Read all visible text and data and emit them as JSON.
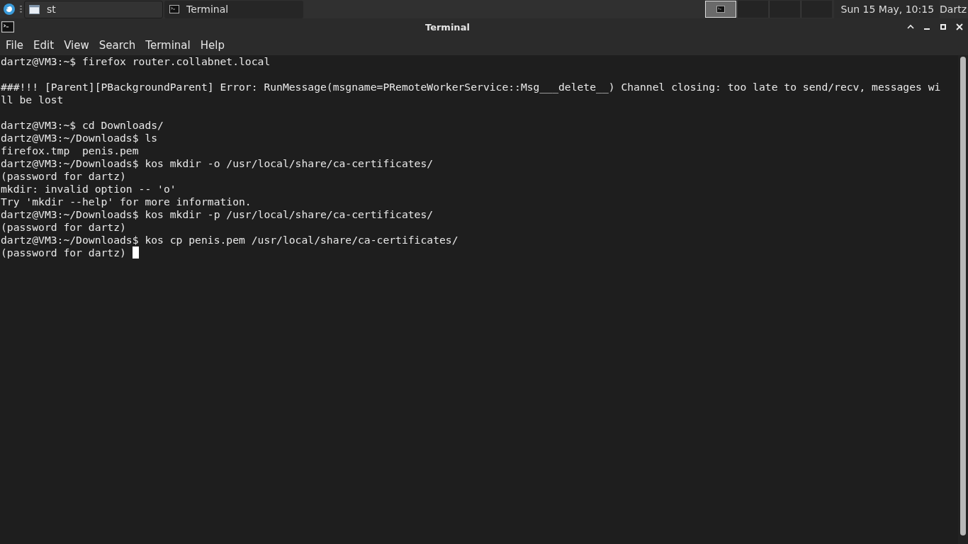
{
  "taskbar": {
    "tasks": [
      {
        "label": "st",
        "selected": true
      },
      {
        "label": "Terminal",
        "selected": false
      }
    ],
    "workspaces": [
      {
        "selected": true
      },
      {
        "selected": false
      },
      {
        "selected": false
      },
      {
        "selected": false
      }
    ],
    "clock": "Sun 15 May, 10:15",
    "user": "Dartz"
  },
  "window": {
    "title": "Terminal"
  },
  "menu": [
    "File",
    "Edit",
    "View",
    "Search",
    "Terminal",
    "Help"
  ],
  "terminal": {
    "lines": [
      {
        "kind": "text",
        "text": "dartz@VM3:~$ firefox router.collabnet.local"
      },
      {
        "kind": "blank"
      },
      {
        "kind": "text",
        "text": "###!!! [Parent][PBackgroundParent] Error: RunMessage(msgname=PRemoteWorkerService::Msg___delete__) Channel closing: too late to send/recv, messages wi"
      },
      {
        "kind": "text",
        "text": "ll be lost"
      },
      {
        "kind": "blank"
      },
      {
        "kind": "text",
        "text": "dartz@VM3:~$ cd Downloads/"
      },
      {
        "kind": "text",
        "text": "dartz@VM3:~/Downloads$ ls"
      },
      {
        "kind": "text",
        "text": "firefox.tmp  penis.pem"
      },
      {
        "kind": "text",
        "text": "dartz@VM3:~/Downloads$ kos mkdir -o /usr/local/share/ca-certificates/"
      },
      {
        "kind": "text",
        "text": "(password for dartz)"
      },
      {
        "kind": "text",
        "text": "mkdir: invalid option -- 'o'"
      },
      {
        "kind": "text",
        "text": "Try 'mkdir --help' for more information."
      },
      {
        "kind": "text",
        "text": "dartz@VM3:~/Downloads$ kos mkdir -p /usr/local/share/ca-certificates/"
      },
      {
        "kind": "text",
        "text": "(password for dartz)"
      },
      {
        "kind": "text",
        "text": "dartz@VM3:~/Downloads$ kos cp penis.pem /usr/local/share/ca-certificates/"
      },
      {
        "kind": "prompt",
        "text": "(password for dartz) "
      }
    ]
  }
}
